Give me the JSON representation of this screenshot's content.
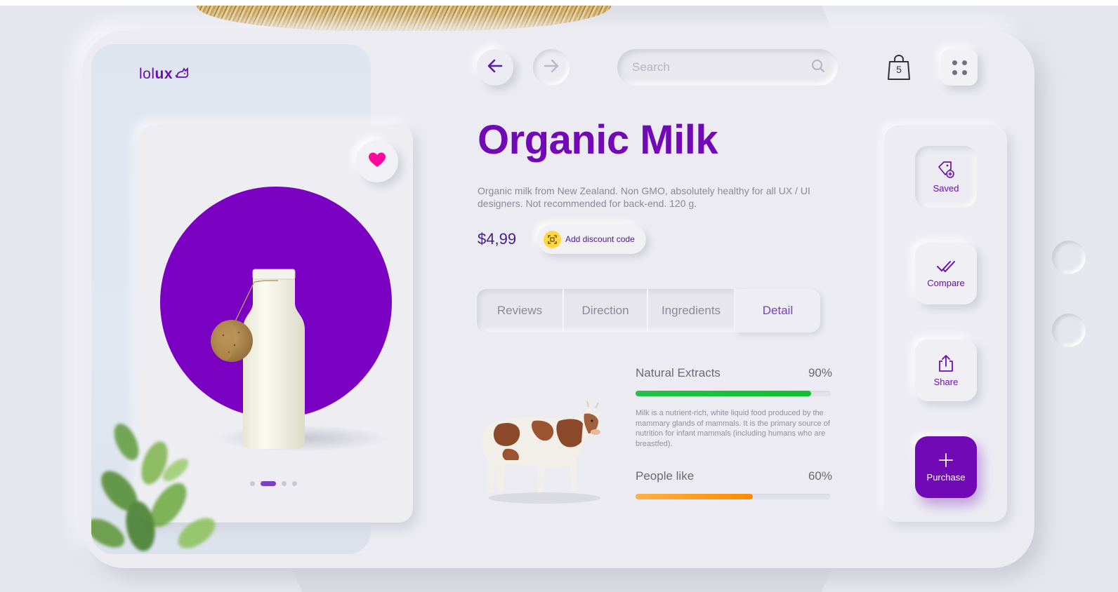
{
  "brand": {
    "logo_light": "lol",
    "logo_bold": "ux",
    "logo_icon": "cat-icon"
  },
  "nav": {
    "back_icon": "arrow-left-icon",
    "forward_icon": "arrow-right-icon",
    "search_placeholder": "Search",
    "cart_count": "5",
    "menu_icon": "grid-dots-icon"
  },
  "product": {
    "title": "Organic Milk",
    "description": "Organic milk from New Zealand. Non GMO, absolutely healthy for all UX / UI designers. Not recommended for back-end. 120 g.",
    "price": "$4,99",
    "discount_label": "Add discount code",
    "favorite": true,
    "carousel": {
      "count": 4,
      "active_index": 1
    }
  },
  "tabs": [
    {
      "label": "Reviews",
      "active": false
    },
    {
      "label": "Direction",
      "active": false
    },
    {
      "label": "Ingredients",
      "active": false
    },
    {
      "label": "Detail",
      "active": true
    }
  ],
  "details": {
    "stats": [
      {
        "label": "Natural Extracts",
        "percent_label": "90%",
        "value": 0.9,
        "color": "#12c233"
      },
      {
        "label": "People like",
        "percent_label": "60%",
        "value": 0.6,
        "color": "#ff8c00"
      }
    ],
    "text": "Milk is a nutrient-rich, white liquid food produced by the mammary glands of mammals. It is the primary source of nutrition for infant mammals (including humans who are breastfed)."
  },
  "actions": {
    "saved": "Saved",
    "compare": "Compare",
    "share": "Share",
    "purchase": "Purchase"
  },
  "colors": {
    "accent": "#7209b7",
    "heart": "#ff0a9c",
    "discount_icon_bg": "#ffd83d"
  }
}
